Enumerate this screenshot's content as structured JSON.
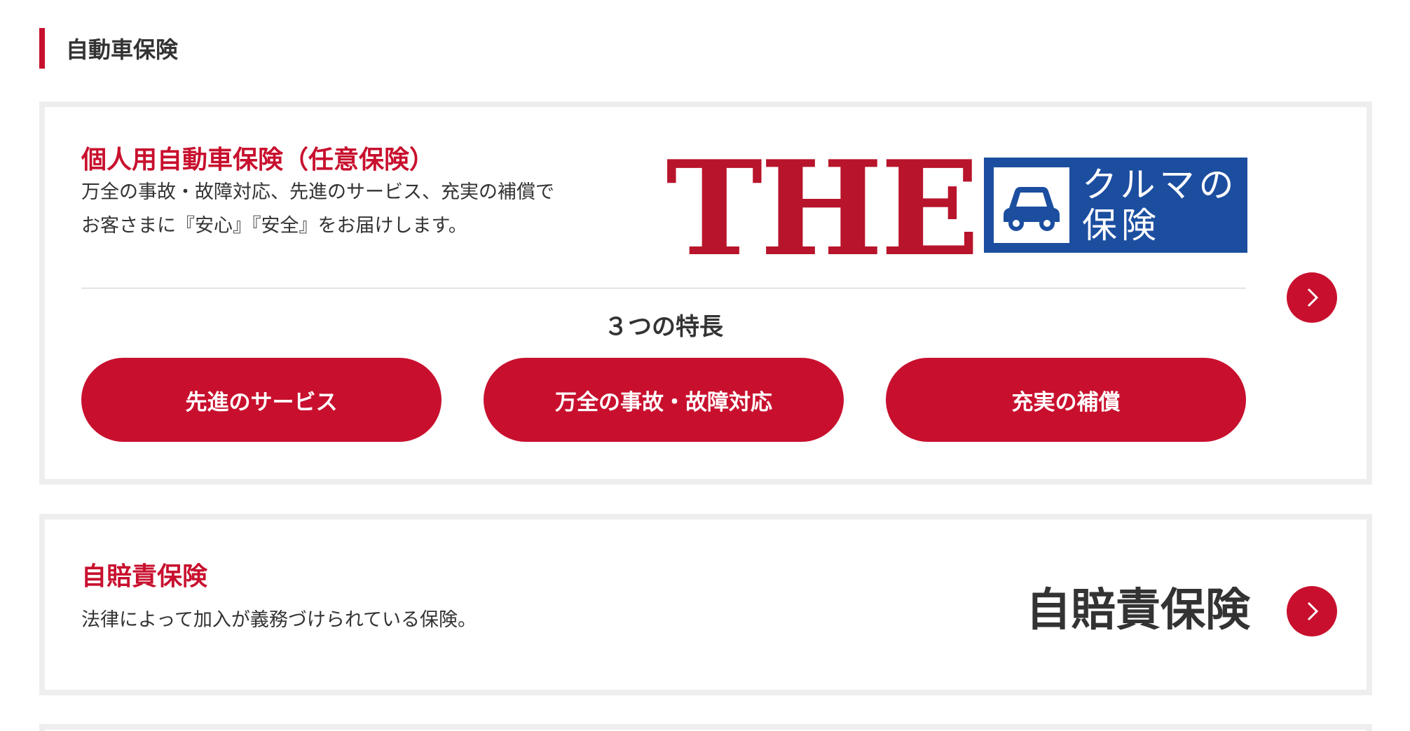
{
  "section": {
    "heading": "自動車保険"
  },
  "card1": {
    "title": "個人用自動車保険（任意保険）",
    "description_line1": "万全の事故・故障対応、先進のサービス、充実の補償で",
    "description_line2": "お客さまに『安心』『安全』をお届けします。",
    "logo": {
      "the_text": "THE",
      "box_line1": "クルマの",
      "box_line2": "保険",
      "car_icon": "car-icon"
    },
    "features_heading": "３つの特長",
    "features": [
      {
        "label": "先進のサービス"
      },
      {
        "label": "万全の事故・故障対応"
      },
      {
        "label": "充実の補償"
      }
    ],
    "arrow_icon": "chevron-right-icon"
  },
  "card2": {
    "title": "自賠責保険",
    "description": "法律によって加入が義務づけられている保険。",
    "logo_text": "自賠責保険",
    "arrow_icon": "chevron-right-icon"
  },
  "colors": {
    "accent": "#c8102e",
    "logo_blue": "#1c4e9f",
    "card_border": "#eeeeee",
    "text": "#333333"
  }
}
